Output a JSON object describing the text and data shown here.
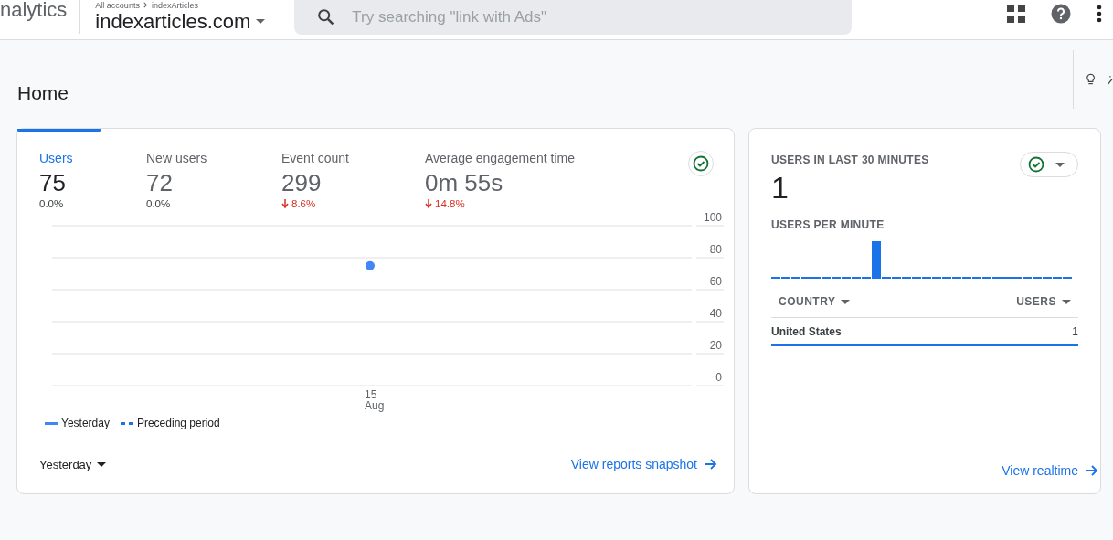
{
  "header": {
    "brand": "nalytics",
    "breadcrumb": [
      "All accounts",
      "indexArticles"
    ],
    "property": "indexarticles.com",
    "search": {
      "placeholder": "Try searching \"link with Ads\""
    }
  },
  "page": {
    "title": "Home"
  },
  "overview": {
    "metrics": [
      {
        "label": "Users",
        "value": "75",
        "change": "0.0%",
        "decreased": false,
        "selected": true
      },
      {
        "label": "New users",
        "value": "72",
        "change": "0.0%",
        "decreased": false,
        "selected": false
      },
      {
        "label": "Event count",
        "value": "299",
        "change": "8.6%",
        "decreased": true,
        "selected": false
      },
      {
        "label": "Average engagement time",
        "value": "0m 55s",
        "change": "14.8%",
        "decreased": true,
        "selected": false
      }
    ],
    "chart_data": {
      "type": "line",
      "categories": [
        "15 Aug"
      ],
      "series": [
        {
          "name": "Yesterday",
          "color": "#4285f4",
          "marker": "circle",
          "values": [
            75
          ]
        },
        {
          "name": "Preceding period",
          "color": "#1a73e8",
          "values": [
            null
          ]
        }
      ],
      "ylim": [
        0,
        100
      ],
      "yticks": [
        0,
        20,
        40,
        60,
        80,
        100
      ],
      "grid": true
    },
    "date_range": "Yesterday",
    "link": "View reports snapshot"
  },
  "realtime": {
    "title": "USERS IN LAST 30 MINUTES",
    "value": "1",
    "subtitle": "USERS PER MINUTE",
    "columns": [
      "COUNTRY",
      "USERS"
    ],
    "rows": [
      {
        "country": "United States",
        "users": "1"
      }
    ],
    "link": "View realtime"
  }
}
